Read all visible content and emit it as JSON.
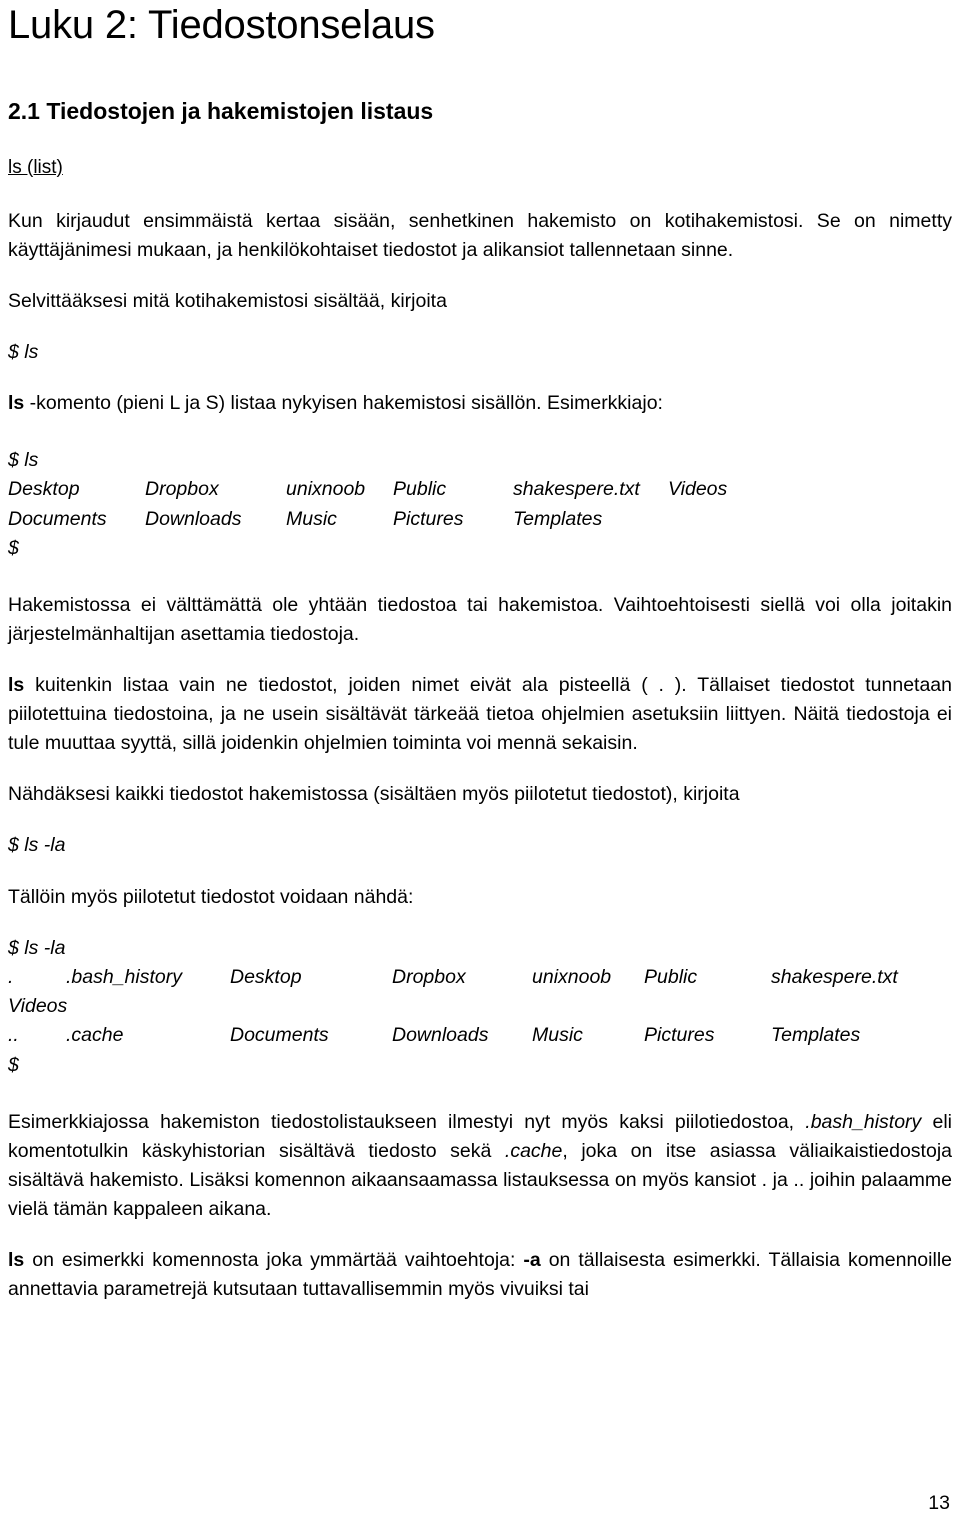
{
  "document": {
    "chapter_title": "Luku 2: Tiedostonselaus",
    "section_title": "2.1 Tiedostojen ja hakemistojen listaus",
    "sub_heading": "ls (list)",
    "page_number": "13"
  },
  "paragraphs": {
    "intro": "Kun kirjaudut ensimmäistä kertaa sisään, senhetkinen hakemisto on kotihakemistosi. Se on nimetty käyttäjänimesi mukaan, ja henkilökohtaiset tiedostot ja alikansiot tallennetaan sinne.",
    "find_out": "Selvittääksesi mitä kotihakemistosi sisältää, kirjoita",
    "ls_explain_cmd": "ls",
    "ls_explain_rest": " -komento (pieni L ja S) listaa nykyisen hakemistosi sisällön. Esimerkkiajo:",
    "maybe_empty": "Hakemistossa ei välttämättä ole yhtään tiedostoa tai hakemistoa. Vaihtoehtoisesti siellä voi olla joitakin järjestelmänhaltijan asettamia tiedostoja.",
    "hidden_cmd": "ls",
    "hidden_rest": " kuitenkin listaa vain ne tiedostot, joiden nimet eivät ala pisteellä ( . ). Tällaiset tiedostot tunnetaan piilotettuina tiedostoina, ja ne usein sisältävät tärkeää tietoa ohjelmien asetuksiin liittyen. Näitä tiedostoja ei tule muuttaa syyttä, sillä joidenkin ohjelmien toiminta voi mennä sekaisin.",
    "see_all": "Nähdäksesi kaikki tiedostot hakemistossa (sisältäen myös piilotetut tiedostot), kirjoita",
    "then_hidden": "Tällöin myös piilotetut tiedostot voidaan nähdä:",
    "explain_1": "Esimerkkiajossa hakemiston tiedostolistaukseen ilmestyi nyt myös kaksi piilotiedostoa, ",
    "explain_file_1": ".bash_history",
    "explain_2": " eli komentotulkin käskyhistorian sisältävä tiedosto sekä ",
    "explain_file_2": ".cache",
    "explain_3": ", joka on itse asiassa väliaikaistiedostoja sisältävä hakemisto. Lisäksi komennon aikaansaamassa listauksessa on myös kansiot . ja .. joihin palaamme vielä tämän kappaleen aikana.",
    "options_cmd": "ls",
    "options_mid": " on esimerkki komennosta joka ymmärtää vaihtoehtoja: ",
    "options_flag": "-a",
    "options_rest": " on tällaisesta esimerkki. Tällaisia komennoille annettavia parametrejä kutsutaan tuttavallisemmin myös vivuiksi tai"
  },
  "terminal": {
    "prompt_ls_1": "$ ls",
    "prompt_ls_2": "$ ls",
    "prompt_ls_la_1": "$ ls -la",
    "prompt_ls_la_2": "$ ls -la",
    "prompt_bare_1": "$",
    "prompt_bare_2": "$",
    "ls_output": {
      "row1": [
        "Desktop",
        "Dropbox",
        "unixnoob",
        "Public",
        "shakespere.txt",
        "Videos"
      ],
      "row2": [
        "Documents",
        "Downloads",
        "Music",
        "Pictures",
        "Templates"
      ]
    },
    "ls_la_output": {
      "row1": [
        ".",
        ".bash_history",
        "Desktop",
        "Dropbox",
        "unixnoob",
        "Public",
        "shakespere.txt"
      ],
      "row1_wrap": "Videos",
      "row2": [
        "..",
        ".cache",
        "Documents",
        "Downloads",
        "Music",
        "Pictures",
        "Templates"
      ]
    }
  }
}
